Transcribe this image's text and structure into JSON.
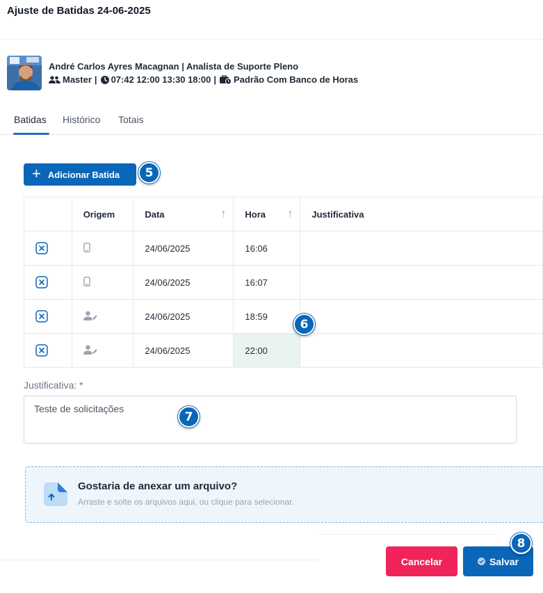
{
  "dialog": {
    "title": "Ajuste de Batidas 24-06-2025"
  },
  "employee": {
    "name_role": "André Carlos Ayres Macagnan | Analista de Suporte Pleno",
    "group": "Master",
    "schedule": "07:42 12:00 13:30 18:00",
    "hours_policy": "Padrão Com Banco de Horas",
    "separator": "|"
  },
  "tabs": [
    {
      "label": "Batidas",
      "active": true
    },
    {
      "label": "Histórico",
      "active": false
    },
    {
      "label": "Totais",
      "active": false
    }
  ],
  "add_button": {
    "label": "Adicionar Batida",
    "plus": "+"
  },
  "table": {
    "headers": {
      "origin": "Origem",
      "date": "Data",
      "time": "Hora",
      "justification": "Justificativa"
    },
    "sort_glyph": "↑",
    "rows": [
      {
        "origin_icon": "mobile-phone-icon",
        "date": "24/06/2025",
        "time": "16:06",
        "justification": ""
      },
      {
        "origin_icon": "mobile-phone-icon",
        "date": "24/06/2025",
        "time": "16:07",
        "justification": ""
      },
      {
        "origin_icon": "user-edit-icon",
        "date": "24/06/2025",
        "time": "18:59",
        "justification": ""
      },
      {
        "origin_icon": "user-edit-icon",
        "date": "24/06/2025",
        "time": "22:00",
        "justification": ""
      }
    ]
  },
  "justification": {
    "label": "Justificativa: *",
    "value": "Teste de solicitações"
  },
  "upload": {
    "title": "Gostaria de anexar um arquivo?",
    "subtitle": "Arraste e solte os arquivos aqui, ou clique para selecionar."
  },
  "buttons": {
    "cancel": "Cancelar",
    "save": "Salvar"
  },
  "steps": {
    "s5": "5",
    "s6": "6",
    "s7": "7",
    "s8": "8"
  },
  "colors": {
    "primary": "#0a66b8",
    "danger": "#f0245b",
    "highlight": "#eaf4ee"
  }
}
